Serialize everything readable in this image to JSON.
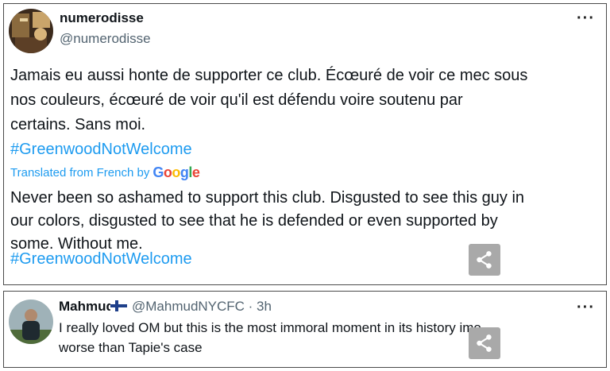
{
  "tweet1": {
    "name": "numerodisse",
    "handle": "@numerodisse",
    "more": "···",
    "original_line1": "Jamais eu aussi honte de supporter ce club. Écœuré de voir ce mec sous",
    "original_line2": "nos couleurs, écœuré de voir qu'il est défendu voire soutenu par",
    "original_line3": "certains. Sans moi.",
    "hashtag": "#GreenwoodNotWelcome",
    "translated_label": "Translated from French by",
    "translated_provider": "Google",
    "translation_line1": "Never been so ashamed to support this club. Disgusted to see this guy in",
    "translation_line2": "our colors, disgusted to see that he is defended or even supported by",
    "translation_line3": "some. Without me.",
    "translation_hashtag": "#GreenwoodNotWelcome"
  },
  "tweet2": {
    "name": "Mahmud",
    "flag": "finland-flag-icon",
    "handle_time": "@MahmudNYCFC · 3h",
    "more": "···",
    "line1": "I really loved OM but this is the most immoral moment in its history imo,",
    "line2": "worse than Tapie's case"
  },
  "colors": {
    "link": "#1d9bf0",
    "handle": "#536471",
    "text": "#0f1419",
    "share_bg": "#a9a9a9"
  }
}
